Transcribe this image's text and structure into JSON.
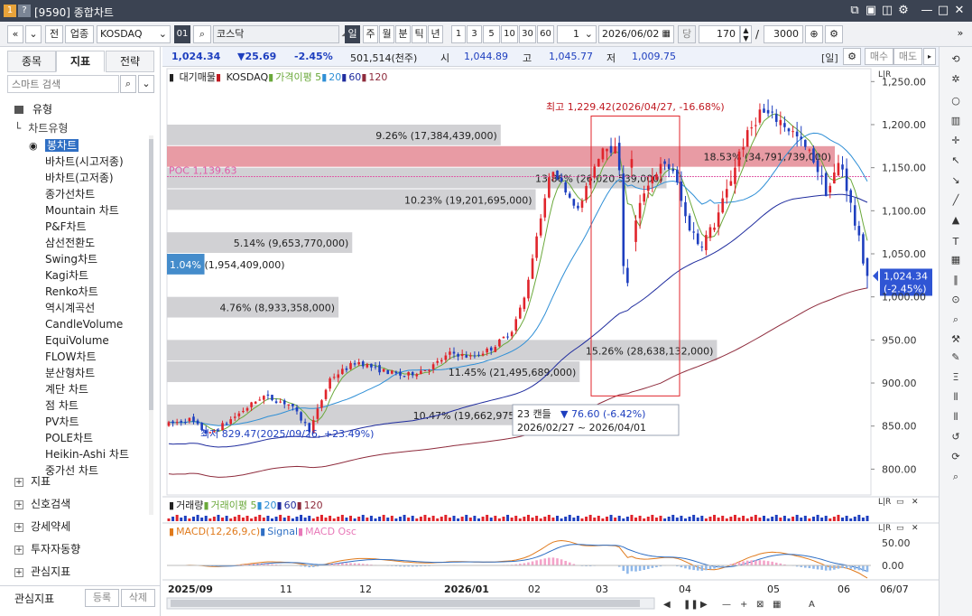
{
  "window": {
    "code_tag": "[9590]",
    "title": "종합차트"
  },
  "toolbar": {
    "jeon": "전",
    "sector": "업종",
    "market": "KOSDAQ",
    "code": "01",
    "name": "코스닥",
    "periods": [
      "일",
      "주",
      "월",
      "분",
      "틱",
      "년"
    ],
    "active_period": "일",
    "minutes": [
      "1",
      "3",
      "5",
      "10",
      "30",
      "60"
    ],
    "unit_value": "1",
    "date": "2026/06/02",
    "dang": "당",
    "count": "170",
    "slash": "/",
    "total": "3000"
  },
  "left": {
    "tabs": [
      "종목",
      "지표",
      "전략"
    ],
    "active_tab": "지표",
    "search_placeholder": "스마트 검색",
    "section_type": "유형",
    "chart_type_header": "차트유형",
    "chart_types": [
      "봉차트",
      "바차트(시고저종)",
      "바차트(고저종)",
      "종가선차트",
      "Mountain 차트",
      "P&F차트",
      "삼선전환도",
      "Swing차트",
      "Kagi차트",
      "Renko차트",
      "역시계곡선",
      "CandleVolume",
      "EquiVolume",
      "FLOW차트",
      "분산형차트",
      "계단 차트",
      "점 차트",
      "PV차트",
      "POLE차트",
      "Heikin-Ashi 차트",
      "중가선 차트"
    ],
    "selected_type": "봉차트",
    "sections": [
      "지표",
      "신호검색",
      "강세약세",
      "투자자동향",
      "관심지표"
    ],
    "footer_label": "관심지표",
    "footer_register": "등록",
    "footer_delete": "삭제"
  },
  "infobar": {
    "price": "1,024.34",
    "change": "▼25.69",
    "rate": "-2.45%",
    "volume": "501,514(천주)",
    "open_label": "시",
    "open": "1,044.89",
    "high_label": "고",
    "high": "1,045.77",
    "low_label": "저",
    "low": "1,009.75",
    "period_tag": "[일]",
    "buy": "매수",
    "sell": "매도"
  },
  "legend": {
    "vp": "대기매물",
    "main": "KOSDAQ",
    "ma_label": "가격이평 5",
    "ma20": "20",
    "ma60": "60",
    "ma120": "120"
  },
  "annotations": {
    "high": "최고 1,229.42(2026/04/27, -16.68%)",
    "low": "최저 829.47(2025/09/26, +23.49%)",
    "range_count": "23 캔들",
    "range_change": "▼ 76.60 (-6.42%)",
    "range_dates": "2026/02/27 ~ 2026/04/01",
    "poc": "POC 1,139.63",
    "price_tag1": "1,024.34",
    "price_tag2": "(-2.45%)"
  },
  "volume_legend": {
    "label": "거래량",
    "ma": "거래이평 5",
    "ma20": "20",
    "ma60": "60",
    "ma120": "120"
  },
  "macd_legend": {
    "label": "MACD(12,26,9,c)",
    "signal": "Signal",
    "osc": "MACD Osc"
  },
  "x_axis": {
    "labels": [
      {
        "t": "2025/09",
        "bold": true
      },
      {
        "t": "11"
      },
      {
        "t": "12"
      },
      {
        "t": "2026/01",
        "bold": true
      },
      {
        "t": "02"
      },
      {
        "t": "03"
      },
      {
        "t": "04"
      },
      {
        "t": "05"
      },
      {
        "t": "06"
      }
    ],
    "right_label": "06/07",
    "nav_a": "A"
  },
  "chart_data": [
    {
      "type": "candlestick",
      "y_ticks": [
        1250,
        1200,
        1150,
        1100,
        1050,
        1000,
        950,
        900,
        850,
        800
      ],
      "y_tick_labels": [
        "1,250.00",
        "1,200.00",
        "1,150.00",
        "1,100.00",
        "1,050.00",
        "1,000.00",
        "950.00",
        "900.00",
        "850.00",
        "800.00"
      ],
      "ylim": [
        770,
        1265
      ],
      "volume_profile": [
        {
          "pct": "9.26%",
          "vol": "17,384,439,000",
          "low": 1175,
          "high": 1200
        },
        {
          "pct": "18.53%",
          "vol": "34,791,739,000",
          "low": 1150,
          "high": 1175,
          "poc": true
        },
        {
          "pct": "13.86%",
          "vol": "26,020,539,000",
          "low": 1125,
          "high": 1150
        },
        {
          "pct": "10.23%",
          "vol": "19,201,695,000",
          "low": 1100,
          "high": 1125
        },
        {
          "pct": "5.14%",
          "vol": "9,653,770,000",
          "low": 1050,
          "high": 1075
        },
        {
          "pct": "1.04%",
          "vol": "1,954,409,000",
          "low": 1025,
          "high": 1050,
          "current": true
        },
        {
          "pct": "4.76%",
          "vol": "8,933,358,000",
          "low": 975,
          "high": 1000
        },
        {
          "pct": "15.26%",
          "vol": "28,638,132,000",
          "low": 925,
          "high": 950
        },
        {
          "pct": "11.45%",
          "vol": "21,495,689,000",
          "low": 900,
          "high": 925
        },
        {
          "pct": "10.47%",
          "vol": "19,662,975,000",
          "low": 850,
          "high": 875
        }
      ],
      "high_point": 1229.42,
      "low_point": 829.47,
      "last_close": 1024.34,
      "range_box": {
        "top": 1210,
        "bottom": 885
      }
    },
    {
      "type": "bar",
      "name": "MACD",
      "y_ticks": [
        50,
        0
      ],
      "y_tick_labels": [
        "50.00",
        "0.00"
      ]
    }
  ],
  "colors": {
    "up": "#e0242b",
    "down": "#1e3fbf",
    "ma5": "#6aa83a",
    "ma20": "#2f8fd6",
    "ma60": "#1f2c9e",
    "ma120": "#8e2b3c",
    "vp_bar": "#cfcfd2",
    "poc_bar": "#e48a94",
    "cur_bar": "#3a86c8"
  }
}
